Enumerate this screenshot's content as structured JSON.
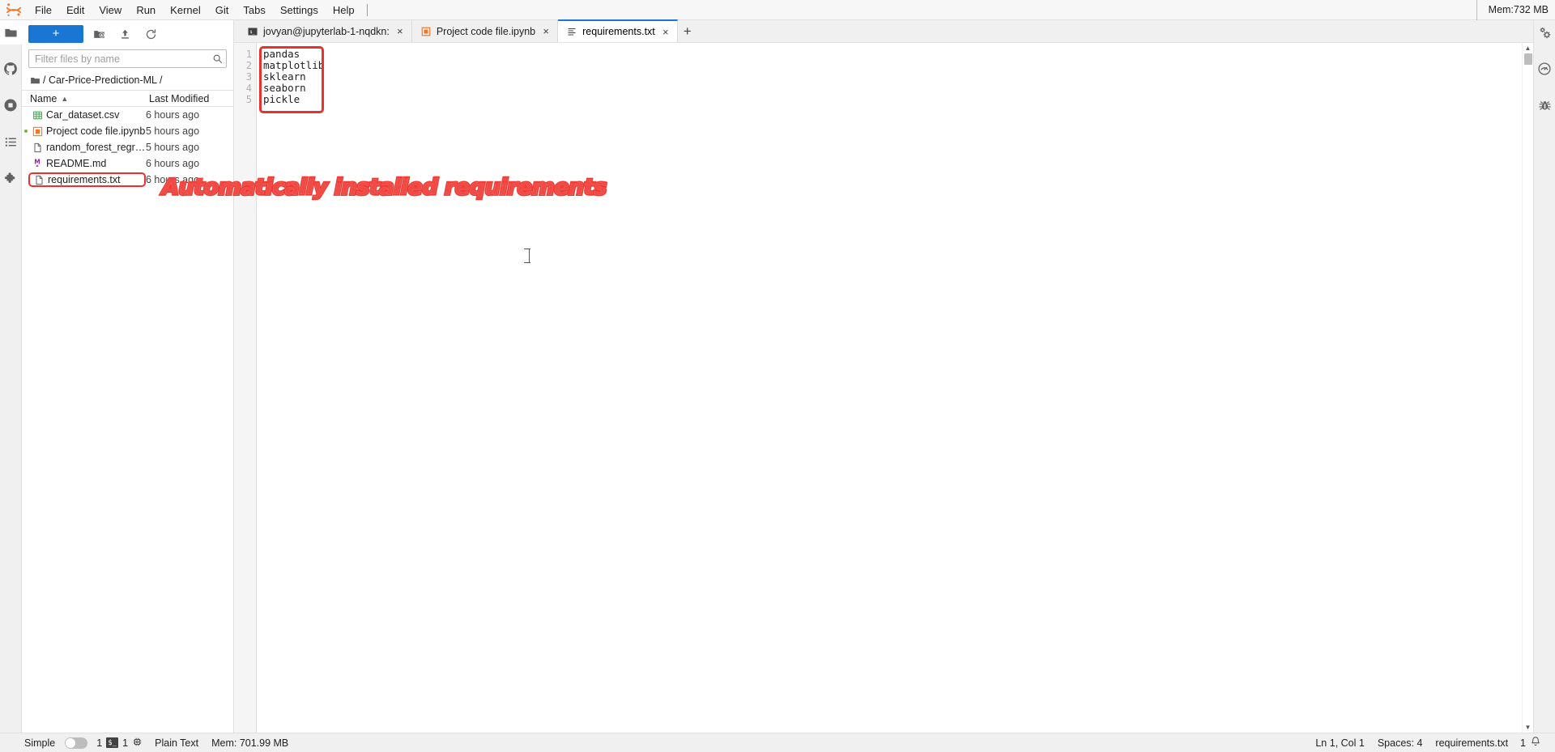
{
  "app": {
    "logo_name": "jupyter-logo",
    "mem_top": "Mem:732 MB"
  },
  "menu": {
    "items": [
      {
        "label": "File",
        "name": "menu-file"
      },
      {
        "label": "Edit",
        "name": "menu-edit"
      },
      {
        "label": "View",
        "name": "menu-view"
      },
      {
        "label": "Run",
        "name": "menu-run"
      },
      {
        "label": "Kernel",
        "name": "menu-kernel"
      },
      {
        "label": "Git",
        "name": "menu-git"
      },
      {
        "label": "Tabs",
        "name": "menu-tabs"
      },
      {
        "label": "Settings",
        "name": "menu-settings"
      },
      {
        "label": "Help",
        "name": "menu-help"
      }
    ]
  },
  "left_sidebar": {
    "items": [
      {
        "name": "file-browser-icon",
        "label": "File Browser",
        "active": true
      },
      {
        "name": "github-icon",
        "label": "GitHub"
      },
      {
        "name": "stop-circle-icon",
        "label": "Running Terminals and Kernels"
      },
      {
        "name": "toc-list-icon",
        "label": "Table of Contents"
      },
      {
        "name": "extension-puzzle-icon",
        "label": "Extension Manager"
      }
    ]
  },
  "right_sidebar": {
    "items": [
      {
        "name": "property-inspector-gears-icon",
        "label": "Property Inspector"
      },
      {
        "name": "dashboard-gauge-icon",
        "label": "Dashboard"
      },
      {
        "name": "debugger-bug-icon",
        "label": "Debugger"
      }
    ]
  },
  "file_browser": {
    "new_button_label": "+",
    "toolbar_buttons": [
      {
        "name": "new-folder-button",
        "label": "New Folder"
      },
      {
        "name": "upload-button",
        "label": "Upload Files"
      },
      {
        "name": "refresh-button",
        "label": "Refresh File List"
      }
    ],
    "filter_placeholder": "Filter files by name",
    "filter_value": "",
    "breadcrumb": "/ Car-Price-Prediction-ML /",
    "columns": {
      "name": "Name",
      "last_modified": "Last Modified"
    },
    "sort_direction": "ascending",
    "files": [
      {
        "name": "Car_dataset.csv",
        "modified": "6 hours ago",
        "icon": "csv-table-icon",
        "running": false,
        "highlight": false
      },
      {
        "name": "Project code file.ipynb",
        "modified": "5 hours ago",
        "icon": "notebook-icon",
        "running": true,
        "highlight": false
      },
      {
        "name": "random_forest_regressi...",
        "modified": "5 hours ago",
        "icon": "file-icon",
        "running": false,
        "highlight": false
      },
      {
        "name": "README.md",
        "modified": "6 hours ago",
        "icon": "markdown-icon",
        "running": false,
        "highlight": false
      },
      {
        "name": "requirements.txt",
        "modified": "6 hours ago",
        "icon": "file-icon",
        "running": false,
        "highlight": true
      }
    ]
  },
  "tabs": [
    {
      "label": "jovyan@jupyterlab-1-nqdkn:",
      "icon": "terminal-icon",
      "active": false,
      "close": "×"
    },
    {
      "label": "Project code file.ipynb",
      "icon": "notebook-icon",
      "active": false,
      "close": "×"
    },
    {
      "label": "requirements.txt",
      "icon": "text-editor-icon",
      "active": true,
      "close": "×"
    }
  ],
  "tab_add_label": "+",
  "editor": {
    "file": "requirements.txt",
    "line_numbers": [
      "1",
      "2",
      "3",
      "4",
      "5"
    ],
    "lines": [
      "pandas",
      "matplotlib",
      "sklearn",
      "seaborn",
      "pickle"
    ]
  },
  "annotation": {
    "text": "Automatically installed requirements",
    "color": "#ef3b35"
  },
  "status_bar": {
    "mode_label": "Simple",
    "kernel_count": "1",
    "terminal_badge": "$_",
    "terminal_count": "1",
    "file_type": "Plain Text",
    "memory": "Mem: 701.99 MB",
    "cursor_position": "Ln 1, Col 1",
    "indentation": "Spaces: 4",
    "file_name": "requirements.txt",
    "notification_count": "1",
    "notification_icon": "bell-icon"
  }
}
